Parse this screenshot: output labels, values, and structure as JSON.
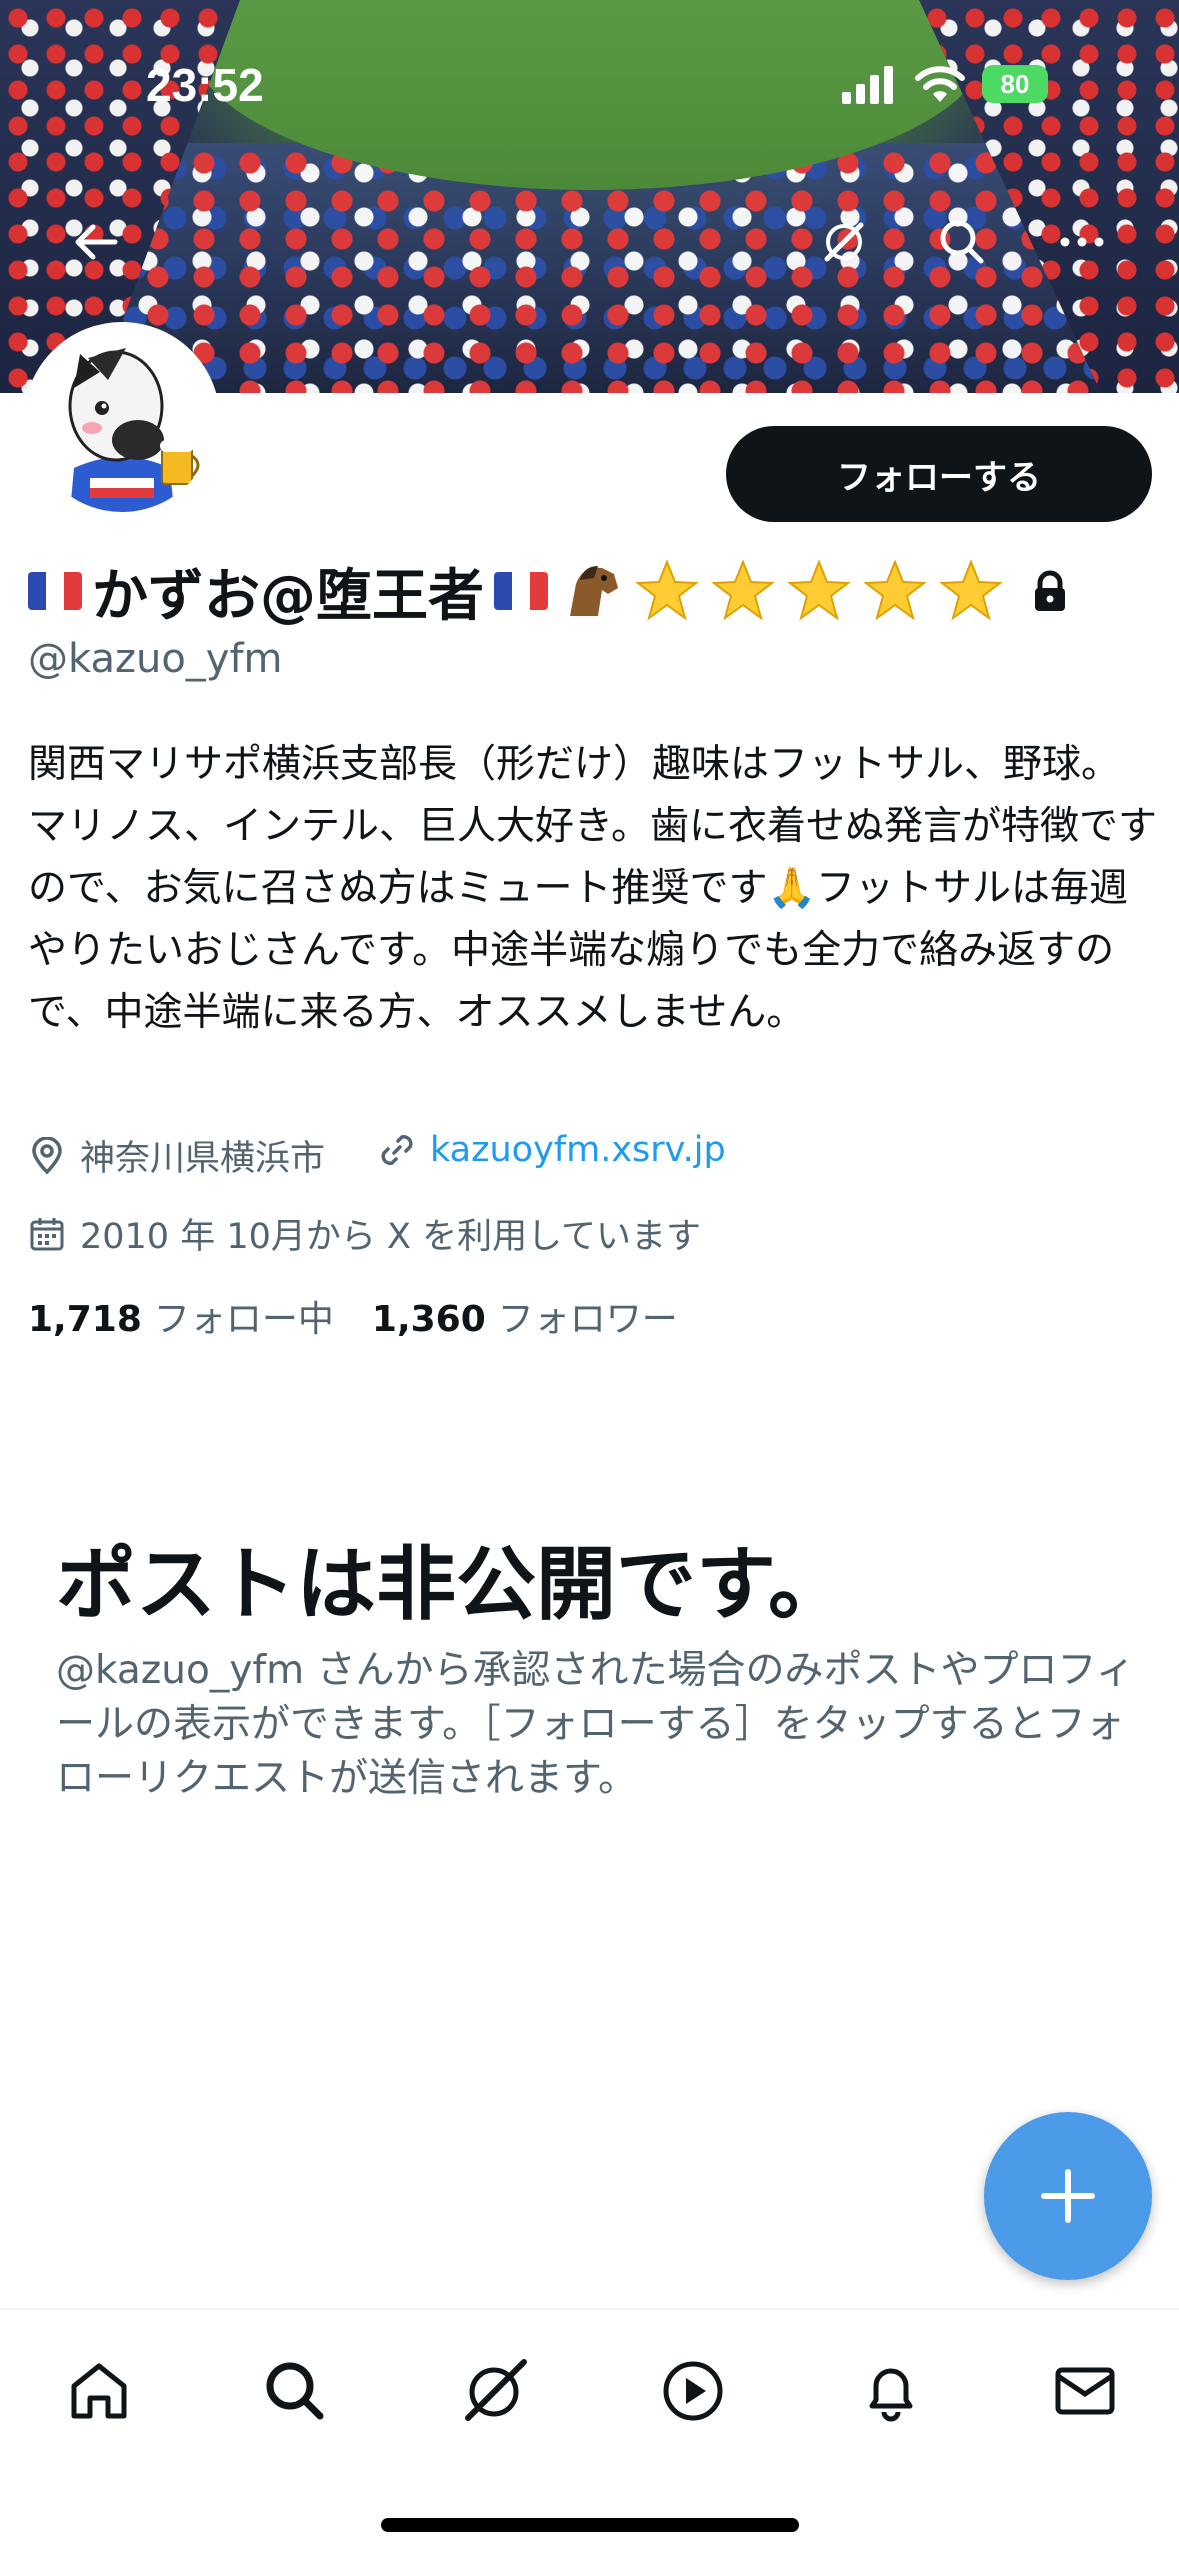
{
  "status_bar": {
    "time": "23:52",
    "battery": "80"
  },
  "profile": {
    "follow_label": "フォローする",
    "display_name": "かずお@堕王者",
    "handle": "@kazuo_yfm",
    "bio": "関西マリサポ横浜支部長（形だけ）趣味はフットサル、野球。マリノス、インテル、巨人大好き。歯に衣着せぬ発言が特徴ですので、お気に召さぬ方はミュート推奨です🙏フットサルは毎週やりたいおじさんです。中途半端な煽りでも全力で絡み返すので、中途半端に来る方、オススメしません。",
    "location": "神奈川県横浜市",
    "website": "kazuoyfm.xsrv.jp",
    "joined": "2010 年 10月から X を利用しています",
    "following_count": "1,718",
    "following_label": "フォロー中",
    "followers_count": "1,360",
    "followers_label": "フォロワー"
  },
  "private_notice": {
    "title": "ポストは非公開です。",
    "description": "@kazuo_yfm さんから承認された場合のみポストやプロフィールの表示ができます。［フォローする］をタップするとフォローリクエストが送信されます。"
  },
  "icons": {
    "top": [
      "back-arrow-icon",
      "grok-icon",
      "search-icon",
      "more-icon"
    ],
    "nav": [
      "home-icon",
      "search-icon",
      "grok-icon",
      "video-icon",
      "notifications-icon",
      "messages-icon"
    ]
  },
  "colors": {
    "accent": "#1d9bf0",
    "fab": "#4c9be8",
    "text_secondary": "#536471",
    "button_dark": "#0f1419"
  }
}
